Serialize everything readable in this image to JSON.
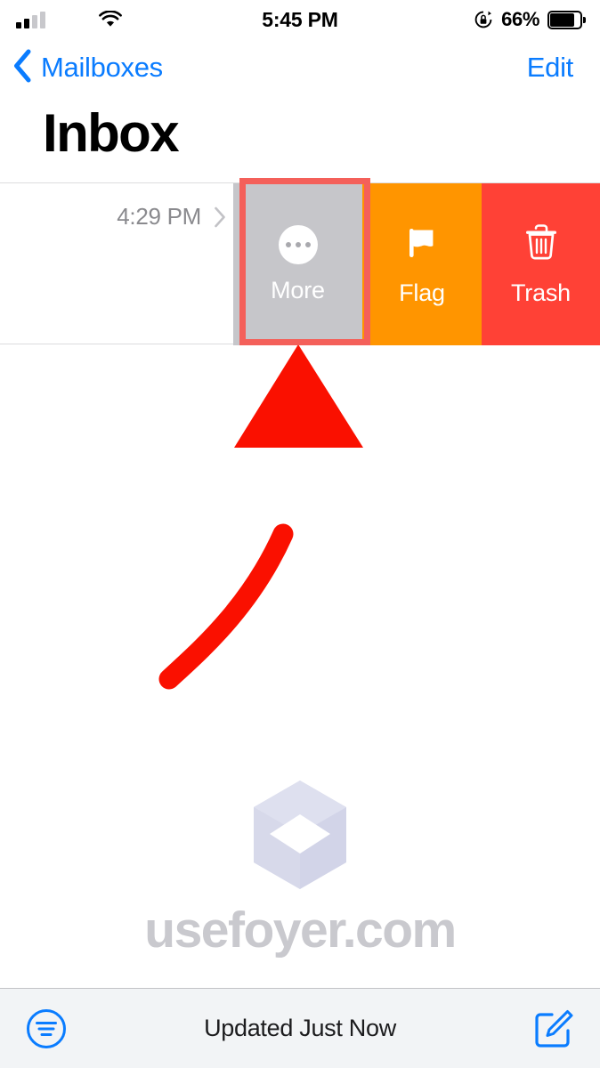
{
  "status_bar": {
    "signal_icon": "cellular-signal-icon",
    "signal_bars_filled": 2,
    "signal_bars_total": 4,
    "wifi_icon": "wifi-icon",
    "time": "5:45 PM",
    "rotation_lock_icon": "rotation-lock-icon",
    "battery_percent": "66%",
    "battery_icon": "battery-icon",
    "battery_level": 66
  },
  "nav_bar": {
    "back_icon": "chevron-left-icon",
    "back_label": "Mailboxes",
    "edit_label": "Edit"
  },
  "page": {
    "title": "Inbox"
  },
  "mail_row": {
    "time": "4:29 PM",
    "disclosure_icon": "chevron-right-icon",
    "swipe_actions": [
      {
        "label": "More",
        "icon": "ellipsis-circle-icon",
        "color": "#C6C6CA",
        "highlighted": true
      },
      {
        "label": "Flag",
        "icon": "flag-icon",
        "color": "#FF9500",
        "highlighted": false
      },
      {
        "label": "Trash",
        "icon": "trash-icon",
        "color": "#FF4136",
        "highlighted": false
      }
    ]
  },
  "annotation": {
    "highlight_color": "#F4605A",
    "arrow_icon": "curved-up-arrow-annotation",
    "arrow_color": "#FA1000",
    "points_to": "More"
  },
  "watermark": {
    "logo_icon": "foyer-cube-logo",
    "text": "usefoyer.com",
    "color": "#C9C9CE"
  },
  "toolbar": {
    "filter_icon": "filter-circle-icon",
    "status_text": "Updated Just Now",
    "compose_icon": "compose-pencil-icon",
    "accent_color": "#0A7CFF"
  }
}
